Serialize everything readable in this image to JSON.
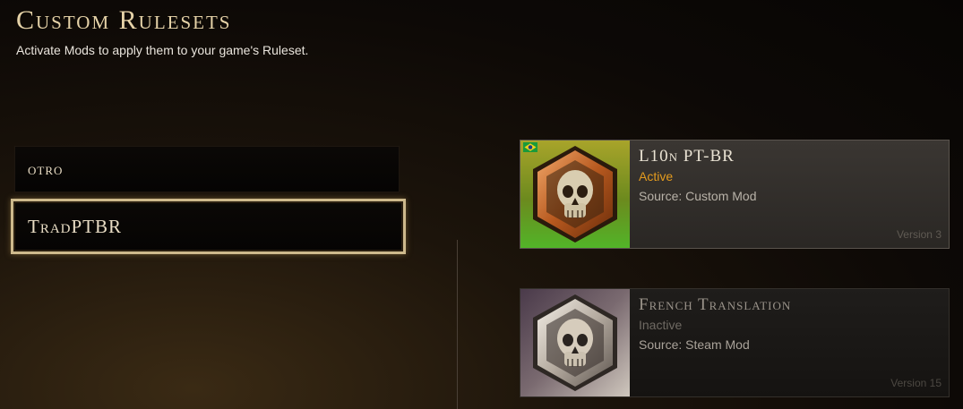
{
  "header": {
    "title": "Custom Rulesets",
    "subtitle": "Activate Mods to apply them to your game's Ruleset."
  },
  "rulesets": [
    {
      "label": "otro",
      "selected": false
    },
    {
      "label": "TradPTBR",
      "selected": true
    }
  ],
  "mods": [
    {
      "name": "L10n PT-BR",
      "status": "Active",
      "status_color": "#e39b1e",
      "source": "Source: Custom Mod",
      "version": "Version 3",
      "flag": "brazil-flag-icon"
    },
    {
      "name": "French Translation",
      "status": "Inactive",
      "status_color": "#6f6a63",
      "source": "Source: Steam Mod",
      "version": "Version 15"
    }
  ],
  "colors": {
    "accent_gold": "#cdb98c",
    "active_orange": "#e39b1e"
  }
}
